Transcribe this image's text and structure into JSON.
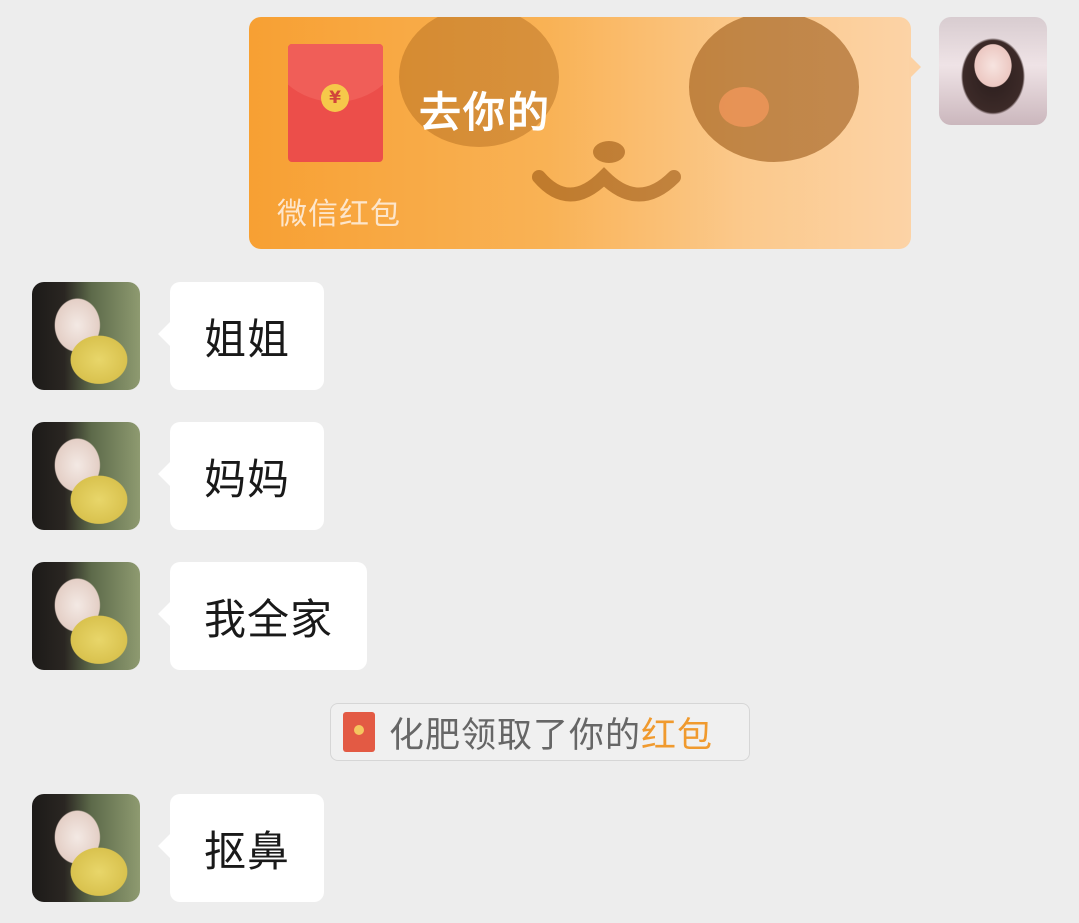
{
  "red_packet_message": {
    "title": "去你的",
    "footer": "微信红包",
    "coin_symbol": "¥",
    "color": "#f7a033"
  },
  "messages": [
    {
      "text": "姐姐"
    },
    {
      "text": "妈妈"
    },
    {
      "text": "我全家"
    },
    {
      "text": "抠鼻"
    }
  ],
  "system_notice": {
    "prefix": "化肥领取了你的",
    "link": "红包",
    "link_color": "#f09a2e"
  }
}
